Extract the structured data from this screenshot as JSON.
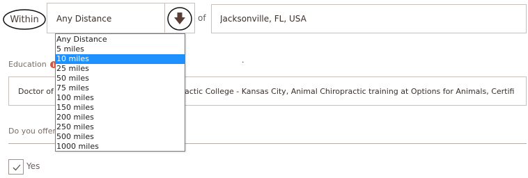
{
  "search": {
    "within_label": "Within",
    "distance_value": "Any Distance",
    "of_label": "of",
    "location_value": "Jacksonville, FL, USA"
  },
  "distance_options": [
    "Any Distance",
    "5 miles",
    "10 miles",
    "25 miles",
    "50 miles",
    "75 miles",
    "100 miles",
    "150 miles",
    "200 miles",
    "250 miles",
    "500 miles",
    "1000 miles"
  ],
  "distance_highlighted": "10 miles",
  "page": {
    "stray_dot": "."
  },
  "education": {
    "label": "Education",
    "info_icon": "info-icon",
    "value_visible_left": "Doctor of",
    "value_visible_right": "actic College - Kansas City, Animal Chiropractic training at Options for Animals, Certifi"
  },
  "offer": {
    "label": "Do you offer",
    "option_label": "Yes",
    "checked": true
  },
  "icons": {
    "dropdown": "arrow-down-icon",
    "check": "checkmark-icon"
  },
  "colors": {
    "border": "#c9bfbb",
    "text": "#3a2f2a",
    "highlight": "#1e90ff",
    "info_badge": "#d6543b"
  }
}
